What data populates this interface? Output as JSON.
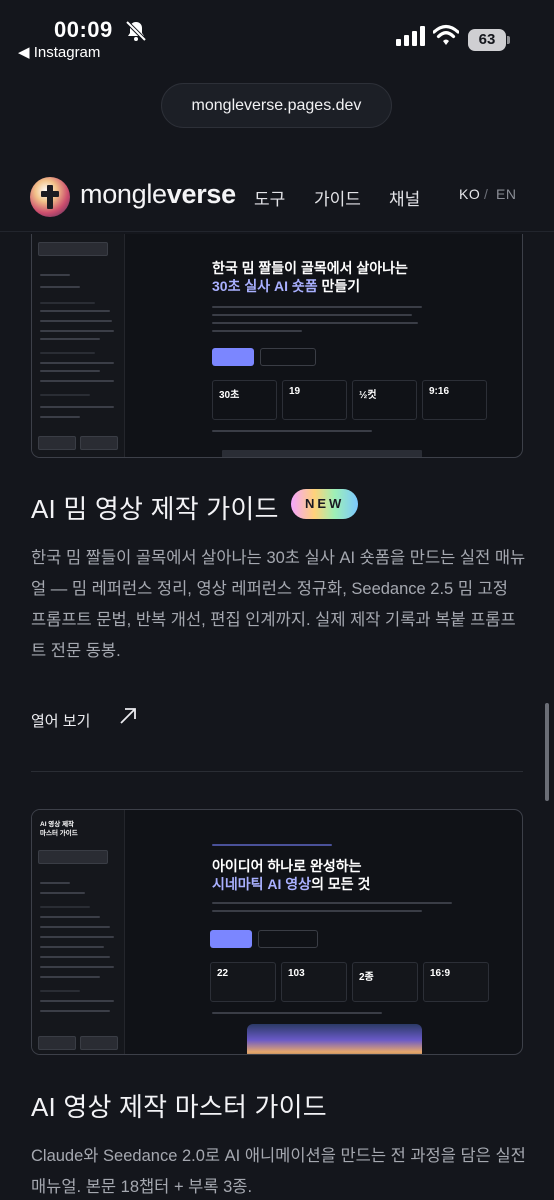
{
  "status_bar": {
    "time": "00:09",
    "back_label": "◀ Instagram",
    "battery": "63",
    "icons": [
      "bell-slash-icon",
      "signal-icon",
      "wifi-icon",
      "battery-icon"
    ]
  },
  "browser": {
    "url": "mongleverse.pages.dev"
  },
  "header": {
    "brand_light": "mongle",
    "brand_bold": "verse",
    "nav": [
      "도구",
      "가이드",
      "채널"
    ],
    "lang_ko": "KO",
    "lang_sep": "/",
    "lang_en": "EN"
  },
  "cards": [
    {
      "title": "AI 밈 영상 제작 가이드",
      "badge": "NEW",
      "description": "한국 밈 짤들이 골목에서 살아나는 30초 실사 AI 숏폼을 만드는 실전 매뉴얼 — 밈 레퍼런스 정리, 영상 레퍼런스 정규화, Seedance 2.5 밈 고정 프롬프트 문법, 반복 개선, 편집 인계까지. 실제 제작 기록과 복붙 프롬프트 전문 동봉.",
      "link": "열어 보기",
      "preview": {
        "hero_line1": "한국 밈 짤들이 골목에서 살아나는",
        "hero_line2_accent": "30초 실사 AI 숏폼",
        "hero_line2_rest": " 만들기",
        "stats": [
          "30초",
          "19",
          "½컷",
          "9:16"
        ]
      }
    },
    {
      "title": "AI 영상 제작 마스터 가이드",
      "description": "Claude와 Seedance 2.0로 AI 애니메이션을 만드는 전 과정을 담은 실전 매뉴얼. 본문 18챕터 + 부록 3종.",
      "preview": {
        "side_title_1": "AI 영상 제작",
        "side_title_2": "마스터 가이드",
        "hero_line1": "아이디어 하나로 완성하는",
        "hero_line2_accent": "시네마틱 AI 영상",
        "hero_line2_rest": "의 모든 것",
        "stats": [
          "22",
          "103",
          "2종",
          "16:9"
        ]
      }
    }
  ],
  "colors": {
    "background": "#14161c",
    "accent": "#7b86ff",
    "text_muted": "#a5a8b0"
  }
}
